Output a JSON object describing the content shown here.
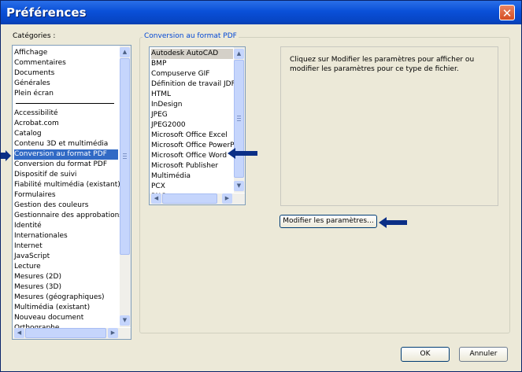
{
  "window": {
    "title": "Préférences"
  },
  "categories_label": "Catégories :",
  "categories_top": [
    "Affichage",
    "Commentaires",
    "Documents",
    "Générales",
    "Plein écran"
  ],
  "categories_bottom": [
    "Accessibilité",
    "Acrobat.com",
    "Catalog",
    "Contenu 3D et multimédia",
    "Conversion au format PDF",
    "Conversion du format PDF",
    "Dispositif de suivi",
    "Fiabilité multimédia (existant)",
    "Formulaires",
    "Gestion des couleurs",
    "Gestionnaire des approbations",
    "Identité",
    "Internationales",
    "Internet",
    "JavaScript",
    "Lecture",
    "Mesures (2D)",
    "Mesures (3D)",
    "Mesures (géographiques)",
    "Multimédia (existant)",
    "Nouveau document",
    "Orthographe"
  ],
  "selected_category": "Conversion au format PDF",
  "group_title": "Conversion au format PDF",
  "formats": [
    "Autodesk AutoCAD",
    "BMP",
    "Compuserve GIF",
    "Définition de travail JDF",
    "HTML",
    "InDesign",
    "JPEG",
    "JPEG2000",
    "Microsoft Office Excel",
    "Microsoft Office PowerPoint",
    "Microsoft Office Word",
    "Microsoft Publisher",
    "Multimédia",
    "PCX",
    "PNG"
  ],
  "selected_format": "Autodesk AutoCAD",
  "info_text": "Cliquez sur Modifier les paramètres pour afficher ou modifier les paramètres pour ce type de fichier.",
  "buttons": {
    "edit_settings": "Modifier les paramètres...",
    "ok": "OK",
    "cancel": "Annuler"
  },
  "colors": {
    "title_bar": "#0a50d8",
    "selection": "#316ac5",
    "annotation_arrow": "#0b2f86"
  },
  "icons": [
    "close-icon",
    "scroll-up-icon",
    "scroll-down-icon",
    "scroll-left-icon",
    "scroll-right-icon",
    "annotation-arrow-icon"
  ]
}
